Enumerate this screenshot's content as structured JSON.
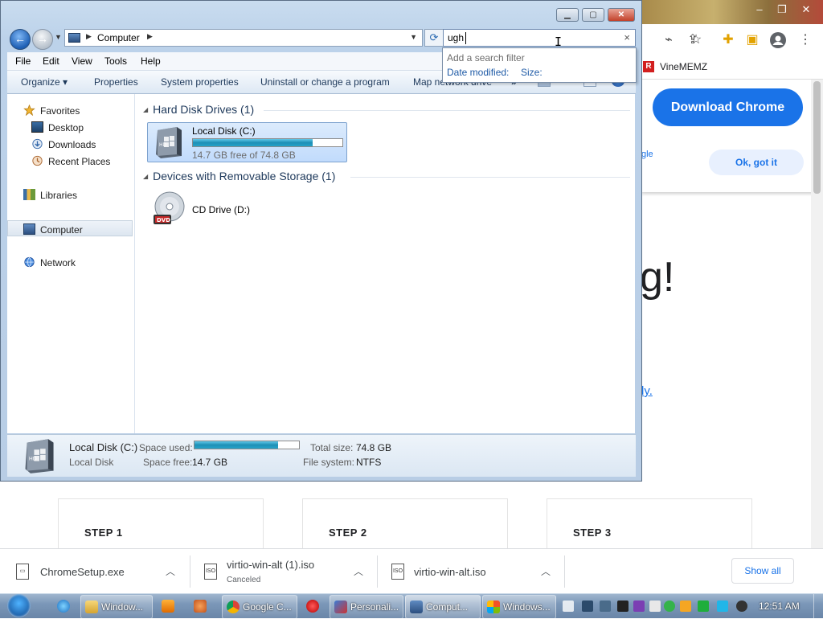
{
  "explorer": {
    "address": {
      "location": "Computer"
    },
    "search": {
      "query": "ugh",
      "dropdown_hint": "Add a search filter",
      "filters": [
        "Date modified:",
        "Size:"
      ]
    },
    "menu": [
      "File",
      "Edit",
      "View",
      "Tools",
      "Help"
    ],
    "commands": [
      "Organize",
      "Properties",
      "System properties",
      "Uninstall or change a program",
      "Map network drive"
    ],
    "nav": {
      "favorites": "Favorites",
      "favorites_items": [
        "Desktop",
        "Downloads",
        "Recent Places"
      ],
      "libraries": "Libraries",
      "computer": "Computer",
      "network": "Network"
    },
    "groups": {
      "hard_disks": "Hard Disk Drives (1)",
      "removable": "Devices with Removable Storage (1)"
    },
    "local_disk": {
      "name": "Local Disk (C:)",
      "free_text": "14.7 GB free of 74.8 GB",
      "used_fraction": 0.8
    },
    "cd_drive": {
      "name": "CD Drive (D:)",
      "badge": "DVD"
    },
    "details": {
      "name": "Local Disk (C:)",
      "type": "Local Disk",
      "space_used_label": "Space used:",
      "space_free_label": "Space free:",
      "space_free": "14.7 GB",
      "total_size_label": "Total size:",
      "total_size": "74.8 GB",
      "file_system_label": "File system:",
      "file_system": "NTFS"
    }
  },
  "chrome_bg": {
    "bookmark": "VineMEMZ",
    "bookmark_icon_letter": "R",
    "download_button": "Download Chrome",
    "ok_button": "Ok, got it",
    "partial_link": "gle",
    "headline_fragment": "g!",
    "link_fragment": "ly.",
    "steps": [
      "STEP 1",
      "STEP 2",
      "STEP 3"
    ]
  },
  "downloads": {
    "items": [
      {
        "name": "ChromeSetup.exe",
        "status": ""
      },
      {
        "name": "virtio-win-alt (1).iso",
        "status": "Canceled"
      },
      {
        "name": "virtio-win-alt.iso",
        "status": ""
      }
    ],
    "show_all": "Show all"
  },
  "taskbar": {
    "buttons": [
      "Window...",
      "Google C...",
      "Personali...",
      "Comput...",
      "Windows..."
    ],
    "clock": "12:51 AM"
  },
  "colors": {
    "accent": "#1a73e8",
    "drive_fill": "#1e8fb5",
    "taskbar": "#7b97b8"
  }
}
